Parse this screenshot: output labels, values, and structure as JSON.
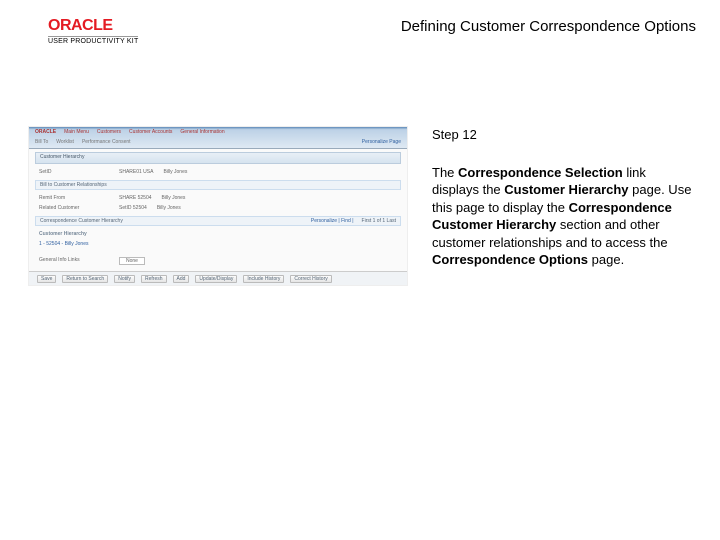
{
  "header": {
    "logo_main": "ORACLE",
    "logo_sub": "USER PRODUCTIVITY KIT",
    "page_title": "Defining Customer Correspondence Options"
  },
  "screenshot": {
    "logo": "ORACLE",
    "nav": [
      "Main Menu",
      "Customers",
      "Customer Accounts",
      "General Information"
    ],
    "tabs": [
      "Bill To",
      "Worklist",
      "Performance Consent"
    ],
    "aux_link": "Personalize Page",
    "section1": "Customer Hierarchy",
    "row1_lbl": "SetID",
    "row1_val": "SHARE01 USA",
    "row1_name": "Billy Jones",
    "section2": "Bill to Customer Relationships",
    "row2_lbl": "Remit From",
    "row2_val": "SHARE   52504",
    "row2_name": "Billy Jones",
    "row3_lbl": "Related Customer",
    "row3_val": "SetID   52504",
    "row3_name": "Billy Jones",
    "list_header": "Correspondence Customer Hierarchy",
    "list_tools": "Personalize | Find |",
    "list_range": "First  1 of 1  Last",
    "list_sub": "Customer Hierarchy",
    "list_item": "1 - 52504 - Billy Jones",
    "footer_lbl": "General Info Links",
    "footer_val": "None",
    "actions": {
      "save": "Save",
      "return": "Return to Search",
      "notify": "Notify",
      "refresh": "Refresh",
      "add": "Add",
      "update": "Update/Display",
      "history": "Include History",
      "correct": "Correct History"
    }
  },
  "instruction": {
    "step": "Step 12",
    "t1": "The ",
    "b1": "Correspondence Selection",
    "t2": " link displays the ",
    "b2": "Customer Hierarchy",
    "t3": " page. Use this page to display the ",
    "b3": "Correspondence Customer Hierarchy",
    "t4": " section and other customer relationships and to access the ",
    "b4": "Correspondence Options",
    "t5": " page."
  }
}
